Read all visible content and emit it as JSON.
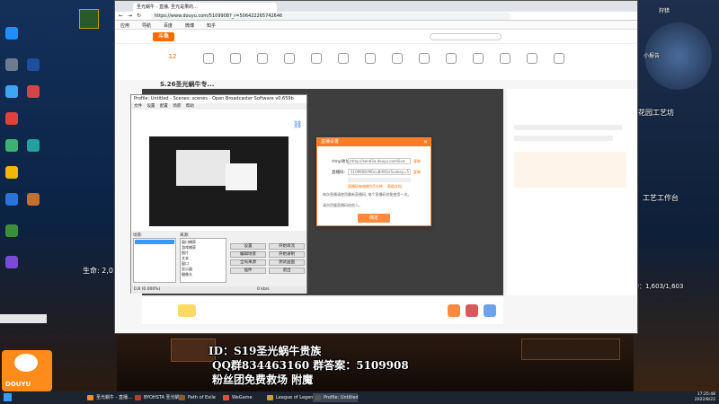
{
  "browser": {
    "tab_title": "圣光蜗牛 - 直播, 圣光是果的...",
    "url": "https://www.douyu.com/5109908?_r=506422265742646",
    "bookmarks": [
      "应用",
      "导航",
      "百度",
      "微博",
      "知乎"
    ]
  },
  "site": {
    "logo": "斗鱼",
    "room_title": "S.26圣光蜗牛专...",
    "follow_count": "12"
  },
  "obs": {
    "title": "Profile: Untitled - Scenes: scenes - Open Broadcaster Software v0.659b",
    "menu": [
      "文件",
      "设置",
      "配置",
      "场景",
      "帮助"
    ],
    "scenes_label": "场景:",
    "sources_label": "来源:",
    "sources": [
      "窗口捕获",
      "游戏捕获",
      "图片",
      "文本",
      "窗口",
      "显示器",
      "摄像头"
    ],
    "buttons": [
      "设置",
      "开始串流",
      "编辑场景",
      "开始录制",
      "全局来源",
      "测试画面",
      "插件",
      "退出"
    ],
    "status": [
      "0.8 (0.000%)",
      "0 kb/s"
    ]
  },
  "dialog": {
    "title": "直播设置",
    "rtmp_label": "rtmp地址:",
    "rtmp_value": "rtmp://send3a.douyu.com/live",
    "key_label": "直播码:",
    "key_value": "5109908rMGcuBr9OsrSunkey=5",
    "copy": "复制",
    "link1": "直播码有效期为5分钟",
    "link2": "帮助文档",
    "note1": "每次直播请使用最新直播码, 每个直播码仅能使用一次。",
    "note2": "请勿泄露直播码给他人。",
    "confirm": "确定"
  },
  "stream": {
    "logo": "DOUYU",
    "id_line": "ID：S19圣光蜗牛贵族",
    "qq_line": "QQ群834463160 群答案：5109908",
    "fan_line": "粉丝团免费救场 附魔"
  },
  "game": {
    "mana": "魔力：1,603/1,603",
    "life": "生命: 2,0",
    "right_labels": [
      "狩猎",
      "小报告",
      "花园工艺坊",
      "工艺工作台"
    ]
  },
  "taskbar": {
    "items": [
      "圣光蜗牛 - 直播...",
      "BYOHSTA 圣光蜗牛",
      "Path of Exile",
      "WeGame",
      "League of Legends",
      "Profile: Untitled"
    ],
    "time": "17:25:48",
    "date": "2022/8/22"
  },
  "colors": {
    "accent": "#ff7b22",
    "douyu": "#ff8c1a"
  }
}
